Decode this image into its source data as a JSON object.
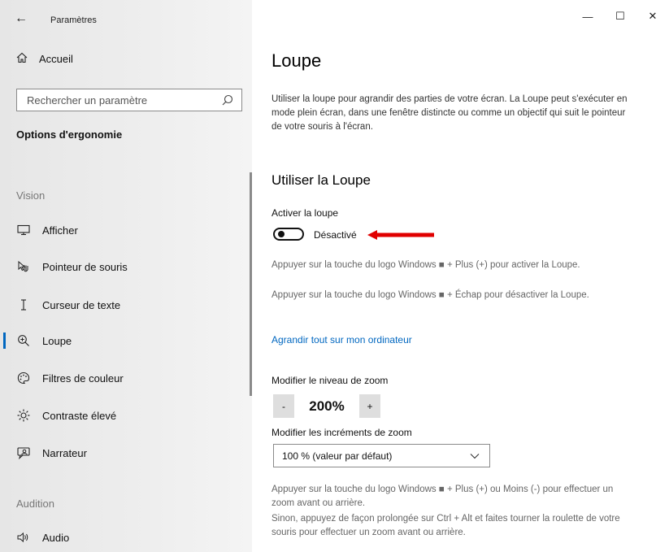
{
  "window": {
    "title": "Paramètres",
    "controls": {
      "minimize": "—",
      "maximize": "☐",
      "close": "✕"
    }
  },
  "sidebar": {
    "home_label": "Accueil",
    "search_placeholder": "Rechercher un paramètre",
    "section_title": "Options d'ergonomie",
    "groups": [
      {
        "label": "Vision",
        "items": [
          {
            "label": "Afficher",
            "icon": "display-icon"
          },
          {
            "label": "Pointeur de souris",
            "icon": "mouse-pointer-icon"
          },
          {
            "label": "Curseur de texte",
            "icon": "text-cursor-icon"
          },
          {
            "label": "Loupe",
            "icon": "magnifier-icon",
            "active": true
          },
          {
            "label": "Filtres de couleur",
            "icon": "color-filter-icon"
          },
          {
            "label": "Contraste élevé",
            "icon": "high-contrast-icon"
          },
          {
            "label": "Narrateur",
            "icon": "narrator-icon"
          }
        ]
      },
      {
        "label": "Audition",
        "items": [
          {
            "label": "Audio",
            "icon": "speaker-icon"
          }
        ]
      }
    ],
    "accent_color": "#0067c0"
  },
  "main": {
    "title": "Loupe",
    "description": "Utiliser la loupe pour agrandir des parties de votre écran. La Loupe peut s'exécuter en mode plein écran, dans une fenêtre distincte ou comme un objectif qui suit le pointeur de votre souris à l'écran.",
    "section_heading": "Utiliser la Loupe",
    "toggle": {
      "label": "Activer la loupe",
      "state_label": "Désactivé",
      "on": false
    },
    "hint_activate": "Appuyer sur la touche du logo Windows ■ + Plus (+) pour activer la Loupe.",
    "hint_deactivate": "Appuyer sur la touche du logo Windows ■ + Échap pour désactiver la Loupe.",
    "link_enlarge": "Agrandir tout sur mon ordinateur",
    "zoom": {
      "label": "Modifier le niveau de zoom",
      "minus": "-",
      "value": "200%",
      "plus": "+"
    },
    "increment": {
      "label": "Modifier les incréments de zoom",
      "selected": "100 % (valeur par défaut)"
    },
    "hint_zoom_keys": "Appuyer sur la touche du logo Windows ■ + Plus (+) ou Moins (-) pour effectuer un zoom avant ou arrière.",
    "hint_zoom_mouse": "Sinon, appuyez de façon prolongée sur Ctrl + Alt et faites tourner la roulette de votre souris pour effectuer un zoom avant ou arrière.",
    "annotation_arrow_color": "#e00000"
  }
}
